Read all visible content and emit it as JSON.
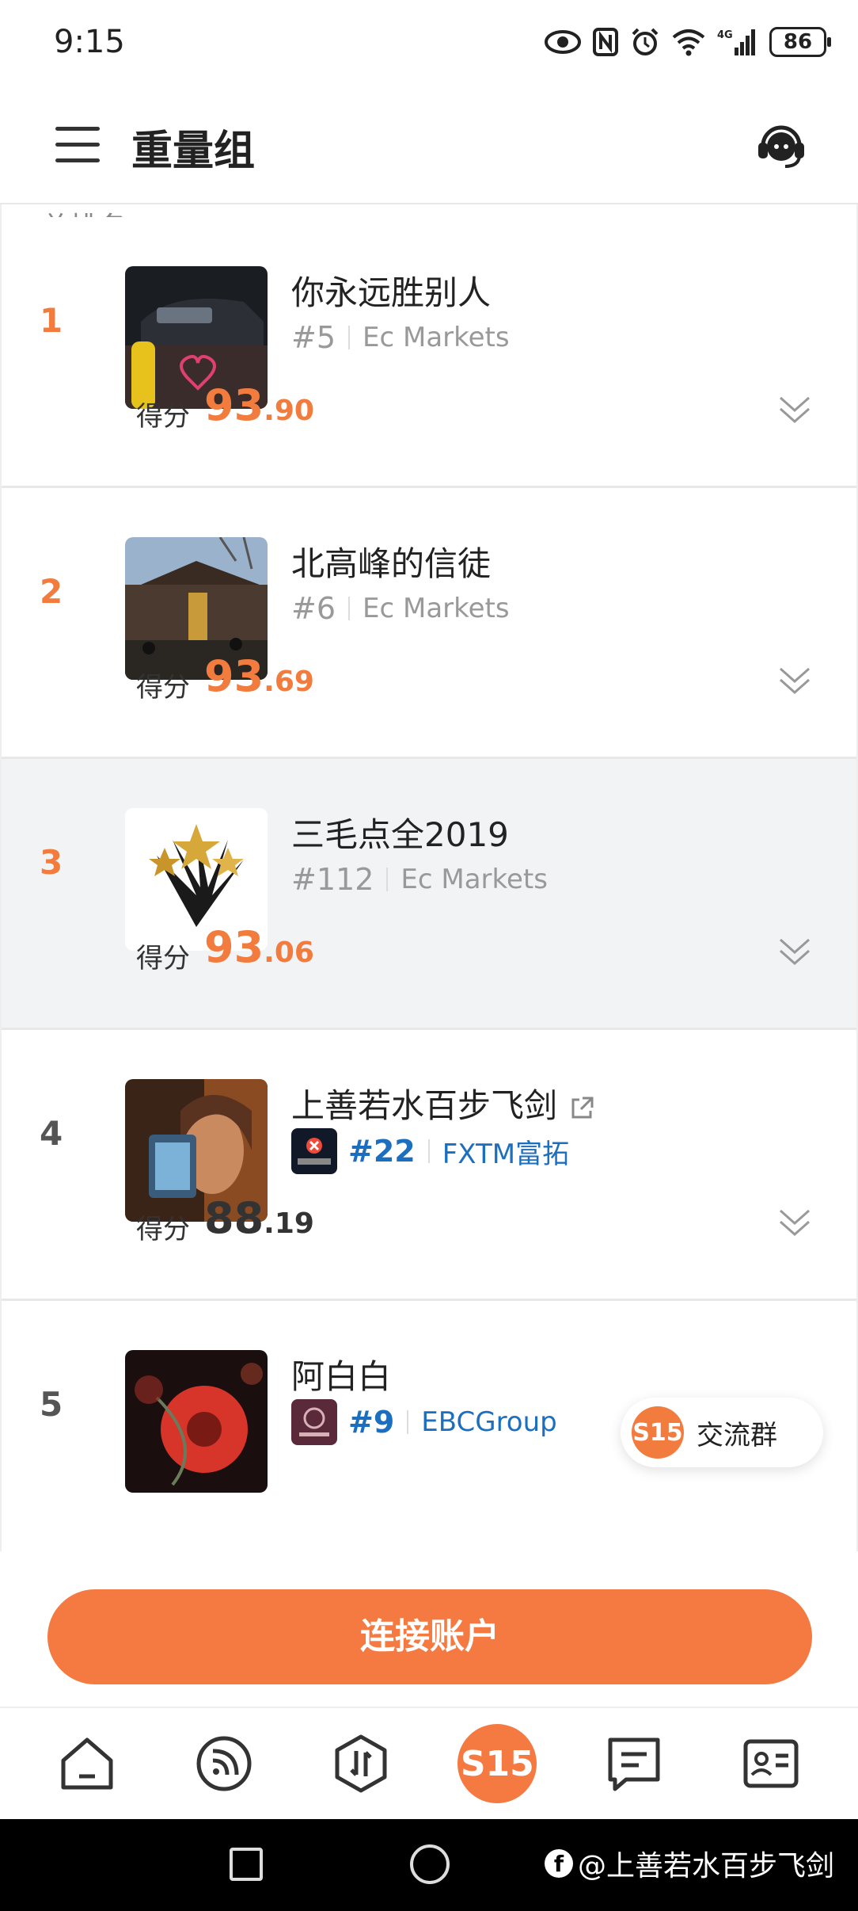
{
  "status_bar": {
    "time": "9:15",
    "battery": "86",
    "network": "4G"
  },
  "header": {
    "title": "重量组"
  },
  "list": {
    "section_label": "总排名",
    "score_label": "得分",
    "items": [
      {
        "rank": "1",
        "name": "你永远胜别人",
        "hash": "#5",
        "broker": "Ec Markets",
        "score_int": "93",
        "score_dec": ".90"
      },
      {
        "rank": "2",
        "name": "北高峰的信徒",
        "hash": "#6",
        "broker": "Ec Markets",
        "score_int": "93",
        "score_dec": ".69"
      },
      {
        "rank": "3",
        "name": "三毛点全2019",
        "hash": "#112",
        "broker": "Ec Markets",
        "score_int": "93",
        "score_dec": ".06"
      },
      {
        "rank": "4",
        "name": "上善若水百步飞剑",
        "hash": "#22",
        "broker": "FXTM富拓",
        "score_int": "88",
        "score_dec": ".19"
      },
      {
        "rank": "5",
        "name": "阿白白",
        "hash": "#9",
        "broker": "EBCGroup"
      }
    ]
  },
  "chat_pill": {
    "badge": "S15",
    "label": "交流群"
  },
  "connect_button": {
    "label": "连接账户"
  },
  "bottom_nav": {
    "center_badge": "S15"
  },
  "watermark": {
    "text": "@上善若水百步飞剑"
  },
  "colors": {
    "accent": "#f47a42",
    "rank_orange": "#f27b3e",
    "link_blue": "#1c6fbf"
  }
}
